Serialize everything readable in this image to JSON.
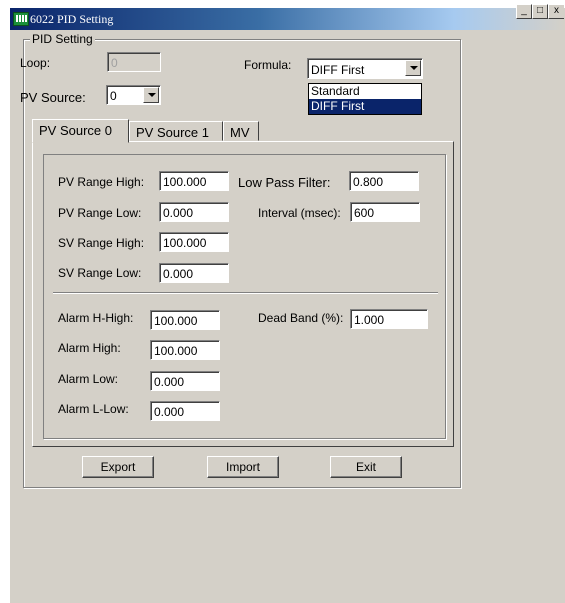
{
  "window": {
    "title": "6022 PID Setting",
    "controls": {
      "minimize": "_",
      "maximize": "□",
      "close": "x"
    }
  },
  "group": {
    "title": "PID Setting"
  },
  "loop": {
    "label": "Loop:",
    "value": "0"
  },
  "pv_source": {
    "label": "PV Source:",
    "value": "0"
  },
  "formula": {
    "label": "Formula:",
    "value": "DIFF First",
    "options": [
      "Standard",
      "DIFF First"
    ],
    "selected_index": 1
  },
  "tabs": [
    {
      "label": "PV Source 0",
      "active": true
    },
    {
      "label": "PV Source 1",
      "active": false
    },
    {
      "label": "MV",
      "active": false
    }
  ],
  "fields": {
    "pv_range_high": {
      "label": "PV Range High:",
      "value": "100.000"
    },
    "pv_range_low": {
      "label": "PV Range Low:",
      "value": "0.000"
    },
    "sv_range_high": {
      "label": "SV Range High:",
      "value": "100.000"
    },
    "sv_range_low": {
      "label": "SV Range Low:",
      "value": "0.000"
    },
    "low_pass_filter": {
      "label": "Low Pass Filter:",
      "value": "0.800"
    },
    "interval": {
      "label": "Interval (msec):",
      "value": "600"
    },
    "alarm_h_high": {
      "label": "Alarm H-High:",
      "value": "100.000"
    },
    "alarm_high": {
      "label": "Alarm High:",
      "value": "100.000"
    },
    "alarm_low": {
      "label": "Alarm Low:",
      "value": "0.000"
    },
    "alarm_l_low": {
      "label": "Alarm L-Low:",
      "value": "0.000"
    },
    "dead_band": {
      "label": "Dead Band (%):",
      "value": "1.000"
    }
  },
  "buttons": {
    "export": "Export",
    "import": "Import",
    "exit": "Exit"
  },
  "colors": {
    "title_bar": "#0a246a",
    "face": "#d4d0c8",
    "selection": "#0a246a",
    "app_icon": "#1a8f3a"
  }
}
